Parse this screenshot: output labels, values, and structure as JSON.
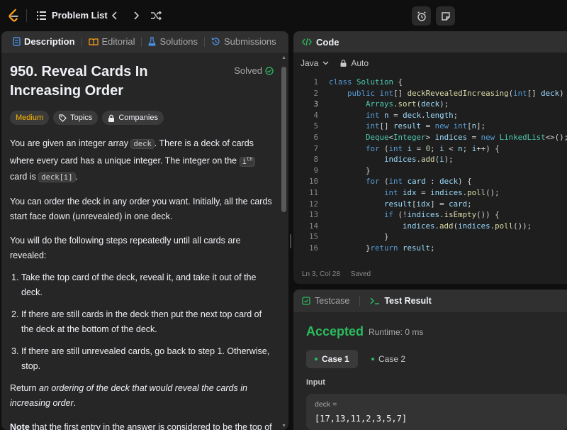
{
  "topbar": {
    "problem_list_label": "Problem List",
    "icons": [
      "leetcode-logo",
      "list-icon",
      "chevron-left-icon",
      "chevron-right-icon",
      "shuffle-icon",
      "alarm-clock-icon",
      "note-icon"
    ]
  },
  "left_tabs": [
    {
      "label": "Description",
      "icon": "document-icon",
      "active": true
    },
    {
      "label": "Editorial",
      "icon": "book-icon",
      "active": false
    },
    {
      "label": "Solutions",
      "icon": "flask-icon",
      "active": false
    },
    {
      "label": "Submissions",
      "icon": "history-icon",
      "active": false
    }
  ],
  "problem": {
    "title": "950. Reveal Cards In Increasing Order",
    "status": "Solved",
    "difficulty": "Medium",
    "topics_label": "Topics",
    "companies_label": "Companies",
    "p1_a": "You are given an integer array ",
    "p1_code1": "deck",
    "p1_b": ". There is a deck of cards where every card has a unique integer. The integer on the ",
    "p1_code2": "i",
    "p1_sup": "th",
    "p1_c": " card is ",
    "p1_code3": "deck[i]",
    "p1_d": ".",
    "p2": "You can order the deck in any order you want. Initially, all the cards start face down (unrevealed) in one deck.",
    "p3": "You will do the following steps repeatedly until all cards are revealed:",
    "steps": [
      "Take the top card of the deck, reveal it, and take it out of the deck.",
      "If there are still cards in the deck then put the next top card of the deck at the bottom of the deck.",
      "If there are still unrevealed cards, go back to step 1. Otherwise, stop."
    ],
    "step_numbers": [
      "1.",
      "2.",
      "3."
    ],
    "p4_a": "Return ",
    "p4_em": "an ordering of the deck that would reveal the cards in increasing order",
    "p4_b": ".",
    "p5_b": "Note",
    "p5_rest": " that the first entry in the answer is considered to be the top of the deck."
  },
  "code_panel": {
    "title": "Code",
    "language": "Java",
    "mode": "Auto",
    "status_position": "Ln 3, Col 28",
    "status_saved": "Saved",
    "current_line": 3,
    "lines": [
      "class Solution {",
      "    public int[] deckRevealedIncreasing(int[] deck) {",
      "        Arrays.sort(deck);",
      "        int n = deck.length;",
      "        int[] result = new int[n];",
      "        Deque<Integer> indices = new LinkedList<>();",
      "        for (int i = 0; i < n; i++) {",
      "            indices.add(i);",
      "        }",
      "        for (int card : deck) {",
      "            int idx = indices.poll();",
      "            result[idx] = card;",
      "            if (!indices.isEmpty()) {",
      "                indices.add(indices.poll());",
      "            }",
      "        }return result;"
    ]
  },
  "test_panel": {
    "testcase_label": "Testcase",
    "result_label": "Test Result",
    "verdict": "Accepted",
    "runtime": "Runtime: 0 ms",
    "case1": "Case 1",
    "case2": "Case 2",
    "input_label": "Input",
    "input_name": "deck =",
    "input_value": "[17,13,11,2,3,5,7]"
  },
  "colors": {
    "accepted": "#2cbb5d",
    "medium": "#ffb800",
    "panel_bg": "#262626",
    "editor_bg": "#1e1e1e"
  }
}
